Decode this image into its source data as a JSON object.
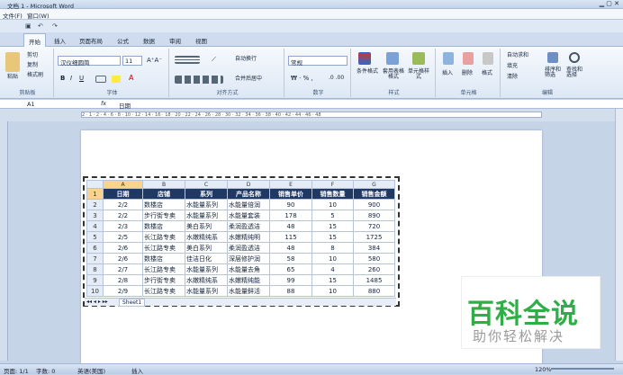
{
  "title": "文档 1 - Microsoft Word",
  "menu": [
    "文件(F)",
    "窗口(W)"
  ],
  "tabs": [
    "开始",
    "插入",
    "页面布局",
    "公式",
    "数据",
    "审阅",
    "视图"
  ],
  "ribbon": {
    "paste": "粘贴",
    "cut": "剪切",
    "copy": "复制",
    "format_painter": "格式刷",
    "font_name": "汉仪细圆简",
    "font_size": "11",
    "wrap_text": "自动换行",
    "merge_center": "合并后居中",
    "number_format": "常规",
    "cond_format": "条件格式",
    "table_style": "套用表格格式",
    "cell_style": "单元格样式",
    "insert": "插入",
    "delete": "删除",
    "format": "格式",
    "autosum": "自动求和",
    "fill": "填充",
    "clear": "清除",
    "sort_filter": "排序和筛选",
    "find_select": "查找和选择",
    "groups": [
      "剪贴板",
      "字体",
      "对齐方式",
      "数字",
      "样式",
      "单元格",
      "编辑"
    ]
  },
  "formula": {
    "cell_ref": "A1",
    "fx": "fx",
    "content": "日期"
  },
  "ruler_text": "2 · 1 · 2 · 4 · 6 · 8 · 10 · 12 · 14 · 16 · 18 · 20 · 22 · 24 · 26 · 28 · 30 · 32 · 34 · 36 · 38 · 40 · 42 · 44 · 46 · 48",
  "sheet": {
    "cols": [
      "A",
      "B",
      "C",
      "D",
      "E",
      "F",
      "G"
    ],
    "header": [
      "日期",
      "店铺",
      "系列",
      "产品名称",
      "销售单价",
      "销售数量",
      "销售金额"
    ],
    "rows": [
      [
        "2/2",
        "数楼店",
        "水能量系列",
        "水能量倍润",
        "90",
        "10",
        "900"
      ],
      [
        "2/2",
        "步行街专卖",
        "水能量系列",
        "水能量套装",
        "178",
        "5",
        "890"
      ],
      [
        "2/3",
        "数楼店",
        "美白系列",
        "柔润盈透洁",
        "48",
        "15",
        "720"
      ],
      [
        "2/5",
        "长江路专卖",
        "水嫩精纯系",
        "水嫩精纯明",
        "115",
        "15",
        "1725"
      ],
      [
        "2/6",
        "长江路专卖",
        "美白系列",
        "柔润盈透洁",
        "48",
        "8",
        "384"
      ],
      [
        "2/6",
        "数楼店",
        "佳洁日化",
        "深层修护润",
        "58",
        "10",
        "580"
      ],
      [
        "2/7",
        "长江路专卖",
        "水能量系列",
        "水能量去角",
        "65",
        "4",
        "260"
      ],
      [
        "2/8",
        "步行街专卖",
        "水嫩精纯系",
        "水嫩精纯能",
        "99",
        "15",
        "1485"
      ],
      [
        "2/9",
        "长江路专卖",
        "水能量系列",
        "水能量鲜活",
        "88",
        "10",
        "880"
      ]
    ],
    "sheet_tab": "Sheet1"
  },
  "watermark": {
    "main": "百科全说",
    "sub": "助你轻松解决"
  },
  "status": {
    "page": "页面: 1/1",
    "words": "字数: 0",
    "lang": "英语(美国)",
    "mode": "插入",
    "zoom": "120%"
  }
}
